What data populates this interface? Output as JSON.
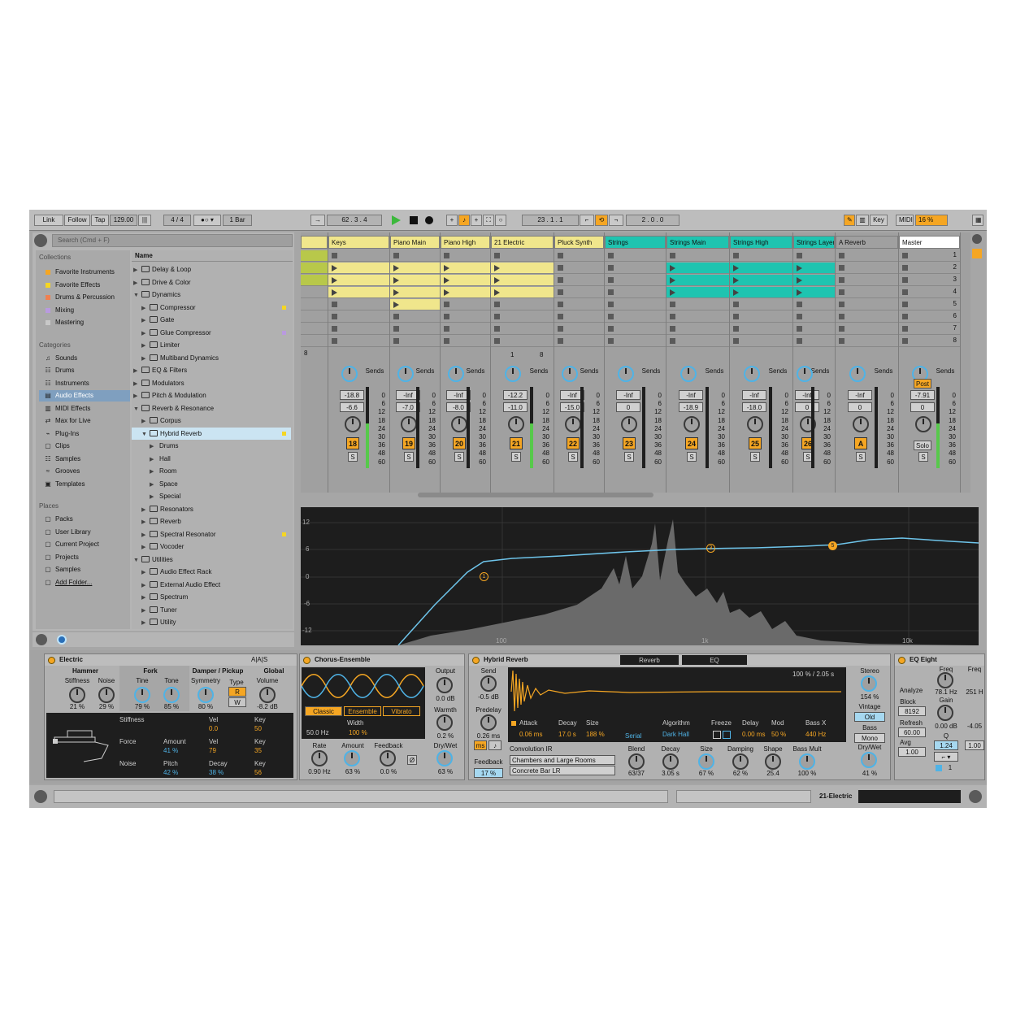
{
  "topbar": {
    "link": "Link",
    "follow": "Follow",
    "tap": "Tap",
    "tempo": "129.00",
    "signature_num": "4",
    "signature_slash": "/",
    "signature_den": "4",
    "quantize": "1 Bar",
    "arrangement_pos": "62 . 3 . 4",
    "loop_start": "23 . 1 . 1",
    "loop_length": "2 . 0 . 0",
    "key": "Key",
    "midi": "MIDI",
    "cpu": "16 %"
  },
  "browser": {
    "search_placeholder": "Search (Cmd + F)",
    "collections_header": "Collections",
    "collections": [
      {
        "label": "Favorite Instruments",
        "color": "#f5a623"
      },
      {
        "label": "Favorite Effects",
        "color": "#f5d623"
      },
      {
        "label": "Drums & Percussion",
        "color": "#f08050"
      },
      {
        "label": "Mixing",
        "color": "#b99adf"
      },
      {
        "label": "Mastering",
        "color": "#c8c8c8"
      }
    ],
    "categories_header": "Categories",
    "categories": [
      "Sounds",
      "Drums",
      "Instruments",
      "Audio Effects",
      "MIDI Effects",
      "Max for Live",
      "Plug-Ins",
      "Clips",
      "Samples",
      "Grooves",
      "Templates"
    ],
    "places_header": "Places",
    "places": [
      "Packs",
      "User Library",
      "Current Project",
      "Projects",
      "Samples",
      "Add Folder..."
    ],
    "name_header": "Name",
    "tree": [
      {
        "label": "Delay & Loop",
        "level": 0,
        "open": false
      },
      {
        "label": "Drive & Color",
        "level": 0,
        "open": false
      },
      {
        "label": "Dynamics",
        "level": 0,
        "open": true
      },
      {
        "label": "Compressor",
        "level": 1,
        "open": false,
        "dot": "#f5d623"
      },
      {
        "label": "Gate",
        "level": 1,
        "open": false
      },
      {
        "label": "Glue Compressor",
        "level": 1,
        "open": false,
        "dot": "#b99adf"
      },
      {
        "label": "Limiter",
        "level": 1,
        "open": false
      },
      {
        "label": "Multiband Dynamics",
        "level": 1,
        "open": false
      },
      {
        "label": "EQ & Filters",
        "level": 0,
        "open": false
      },
      {
        "label": "Modulators",
        "level": 0,
        "open": false
      },
      {
        "label": "Pitch & Modulation",
        "level": 0,
        "open": false
      },
      {
        "label": "Reverb & Resonance",
        "level": 0,
        "open": true
      },
      {
        "label": "Corpus",
        "level": 1,
        "open": false
      },
      {
        "label": "Hybrid Reverb",
        "level": 1,
        "open": true,
        "sel": true,
        "dot": "#f5d623"
      },
      {
        "label": "Drums",
        "level": 2,
        "open": false,
        "nofolder": true
      },
      {
        "label": "Hall",
        "level": 2,
        "open": false,
        "nofolder": true
      },
      {
        "label": "Room",
        "level": 2,
        "open": false,
        "nofolder": true
      },
      {
        "label": "Space",
        "level": 2,
        "open": false,
        "nofolder": true
      },
      {
        "label": "Special",
        "level": 2,
        "open": false,
        "nofolder": true
      },
      {
        "label": "Resonators",
        "level": 1,
        "open": false
      },
      {
        "label": "Reverb",
        "level": 1,
        "open": false
      },
      {
        "label": "Spectral Resonator",
        "level": 1,
        "open": false,
        "dot": "#f5d623"
      },
      {
        "label": "Vocoder",
        "level": 1,
        "open": false
      },
      {
        "label": "Utilities",
        "level": 0,
        "open": true
      },
      {
        "label": "Audio Effect Rack",
        "level": 1,
        "open": false
      },
      {
        "label": "External Audio Effect",
        "level": 1,
        "open": false
      },
      {
        "label": "Spectrum",
        "level": 1,
        "open": false
      },
      {
        "label": "Tuner",
        "level": 1,
        "open": false
      },
      {
        "label": "Utility",
        "level": 1,
        "open": false
      }
    ]
  },
  "session": {
    "sends_label": "Sends",
    "scene_numbers": [
      "1",
      "2",
      "3",
      "4",
      "5",
      "6",
      "7",
      "8"
    ],
    "tracks": [
      {
        "name": "Keys",
        "color": "#f0e68c",
        "vol": "-18.8",
        "pan": "-6.6",
        "num": "18"
      },
      {
        "name": "Piano Main",
        "color": "#f0e68c",
        "vol": "-Inf",
        "pan": "-7.0",
        "num": "19"
      },
      {
        "name": "Piano High",
        "color": "#f0e68c",
        "vol": "-Inf",
        "pan": "-8.0",
        "num": "20"
      },
      {
        "name": "21 Electric",
        "color": "#f0e68c",
        "vol": "-12.2",
        "pan": "-11.0",
        "num": "21"
      },
      {
        "name": "Pluck Synth",
        "color": "#f0e68c",
        "vol": "-Inf",
        "pan": "-15.0",
        "num": "22"
      },
      {
        "name": "Strings",
        "color": "#1fc4b0",
        "vol": "-Inf",
        "pan": "0",
        "num": "23"
      },
      {
        "name": "Strings Main",
        "color": "#1fc4b0",
        "vol": "-Inf",
        "pan": "-18.9",
        "num": "24"
      },
      {
        "name": "Strings High",
        "color": "#1fc4b0",
        "vol": "-Inf",
        "pan": "-18.0",
        "num": "25"
      },
      {
        "name": "Strings Layer",
        "color": "#1fc4b0",
        "vol": "-Inf",
        "pan": "0",
        "num": "26"
      },
      {
        "name": "A Reverb",
        "color": "#a0a0a0",
        "vol": "-Inf",
        "pan": "0",
        "num": "A"
      },
      {
        "name": "Master",
        "color": "#ffffff",
        "vol": "-7.91",
        "pan": "0",
        "num": ""
      }
    ],
    "scale": [
      "0",
      "6",
      "12",
      "18",
      "24",
      "30",
      "36",
      "48",
      "60"
    ],
    "s_label": "S",
    "solo_label": "Solo",
    "post_label": "Post",
    "clip_count_a": "8",
    "clip_count_b": "1",
    "clip_count_c": "8"
  },
  "eq_display": {
    "y_labels": [
      "12",
      "6",
      "0",
      "-6",
      "-12"
    ],
    "x_labels": [
      "100",
      "1k",
      "10k"
    ],
    "band_labels": [
      "1",
      "3",
      "5"
    ]
  },
  "devices": {
    "electric": {
      "title": "Electric",
      "abc": [
        "A",
        "A",
        "S"
      ],
      "groups": [
        "Hammer",
        "Fork",
        "Damper / Pickup",
        "Global"
      ],
      "knobs": [
        {
          "label": "Stiffness",
          "value": "21 %"
        },
        {
          "label": "Noise",
          "value": "29 %"
        },
        {
          "label": "Tine",
          "value": "79 %"
        },
        {
          "label": "Tone",
          "value": "85 %"
        },
        {
          "label": "Symmetry",
          "value": "80 %"
        },
        {
          "label": "Volume",
          "value": "-8.2 dB"
        }
      ],
      "type_label": "Type",
      "type_r": "R",
      "type_w": "W",
      "rows": [
        {
          "name": "Stiffness",
          "cols": [
            {
              "t": "Vel",
              "v": "0.0"
            },
            {
              "t": "Key",
              "v": "50"
            }
          ]
        },
        {
          "name": "Force",
          "cols": [
            {
              "t": "Amount",
              "v": "41 %"
            },
            {
              "t": "Vel",
              "v": "79"
            },
            {
              "t": "Key",
              "v": "35"
            }
          ]
        },
        {
          "name": "Noise",
          "cols": [
            {
              "t": "Pitch",
              "v": "42 %"
            },
            {
              "t": "Decay",
              "v": "38 %"
            },
            {
              "t": "Key",
              "v": "56"
            }
          ]
        }
      ]
    },
    "chorus": {
      "title": "Chorus-Ensemble",
      "modes": [
        "Classic",
        "Ensemble",
        "Vibrato"
      ],
      "freq": "50.0 Hz",
      "width_label": "Width",
      "width": "100 %",
      "output_label": "Output",
      "output": "0.0 dB",
      "warmth_label": "Warmth",
      "warmth": "0.2 %",
      "rate_label": "Rate",
      "rate": "0.90 Hz",
      "amount_label": "Amount",
      "amount": "63 %",
      "feedback_label": "Feedback",
      "feedback": "0.0 %",
      "phase": "Ø",
      "drywet_label": "Dry/Wet",
      "drywet": "63 %"
    },
    "hybrid": {
      "title": "Hybrid Reverb",
      "tab_reverb": "Reverb",
      "tab_eq": "EQ",
      "send_label": "Send",
      "send": "-0.5 dB",
      "predelay_label": "Predelay",
      "predelay": "0.26 ms",
      "ms": "ms",
      "feedback_label": "Feedback",
      "feedback": "17 %",
      "ir_info": "100 % / 2.05 s",
      "params": [
        {
          "t": "Attack",
          "v": "0.06 ms"
        },
        {
          "t": "Decay",
          "v": "17.0 s"
        },
        {
          "t": "Size",
          "v": "188 %"
        },
        {
          "t": "Algorithm",
          "v": "Dark Hall"
        },
        {
          "t": "Freeze",
          "v": ""
        },
        {
          "t": "Delay",
          "v": "0.00 ms"
        },
        {
          "t": "Mod",
          "v": "50 %"
        },
        {
          "t": "Bass X",
          "v": "440 Hz"
        }
      ],
      "serial": "Serial",
      "conv_label": "Convolution IR",
      "ir_cat": "Chambers and Large Rooms",
      "ir_name": "Concrete Bar LR",
      "knobs": [
        {
          "t": "Blend",
          "v": "63/37"
        },
        {
          "t": "Decay",
          "v": "3.05 s"
        },
        {
          "t": "Size",
          "v": "67 %"
        },
        {
          "t": "Damping",
          "v": "62 %"
        },
        {
          "t": "Shape",
          "v": "25.4"
        },
        {
          "t": "Bass Mult",
          "v": "100 %"
        }
      ],
      "stereo_label": "Stereo",
      "stereo": "154 %",
      "vintage_label": "Vintage",
      "vintage": "Old",
      "bass_label": "Bass",
      "bass": "Mono",
      "drywet_label": "Dry/Wet",
      "drywet": "41 %"
    },
    "eq8": {
      "title": "EQ Eight",
      "analyze": "Analyze",
      "block_label": "Block",
      "block": "8192",
      "refresh_label": "Refresh",
      "refresh": "60.00",
      "avg_label": "Avg",
      "avg": "1.00",
      "freq_label": "Freq",
      "freq": "78.1 Hz",
      "freq2": "251 H",
      "gain_label": "Gain",
      "gain": "0.00 dB",
      "gain2": "-4.05",
      "q_label": "Q",
      "q": "1.24",
      "q2": "1.00",
      "band": "1"
    }
  },
  "statusbar": {
    "track_label": "21-Electric"
  },
  "colors": {
    "accent": "#f5a623",
    "teal": "#1fc4b0",
    "yellow": "#f0e68c",
    "blue": "#4fb3e6"
  }
}
